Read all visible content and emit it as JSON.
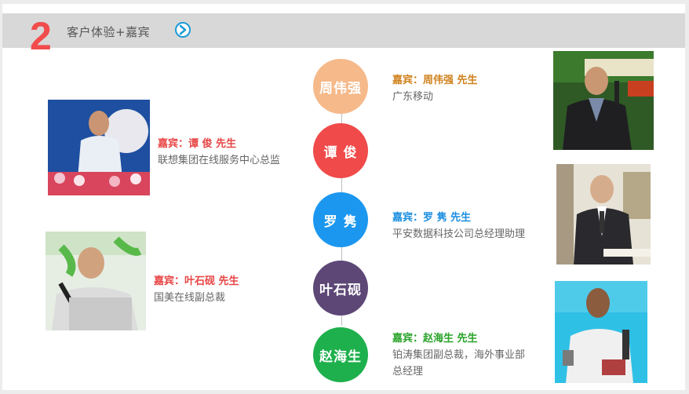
{
  "header": {
    "number": "2",
    "title": "客户体验+嘉宾"
  },
  "speakers": [
    {
      "circle": "周伟强",
      "name": "嘉宾：周伟强 先生",
      "title": "广东移动",
      "color": "#f5b98a",
      "name_color": "#d0811c"
    },
    {
      "circle": "谭 俊",
      "name": "嘉宾：谭 俊 先生",
      "title": "联想集团在线服务中心总监",
      "color": "#f04a4a",
      "name_color": "#e84545"
    },
    {
      "circle": "罗 隽",
      "name": "嘉宾：罗  隽 先生",
      "title": "平安数据科技公司总经理助理",
      "color": "#1c97ef",
      "name_color": "#1c8fe0"
    },
    {
      "circle": "叶石砚",
      "name": "嘉宾：叶石砚 先生",
      "title": "国美在线副总裁",
      "color": "#5d4776",
      "name_color": "#e84545"
    },
    {
      "circle": "赵海生",
      "name": "嘉宾：赵海生 先生",
      "title_line1": "铂涛集团副总裁，海外事业部",
      "title_line2": "总经理",
      "color": "#1eb04c",
      "name_color": "#29a329"
    }
  ],
  "icons": {
    "arrow": "circle-arrow-right-icon"
  }
}
